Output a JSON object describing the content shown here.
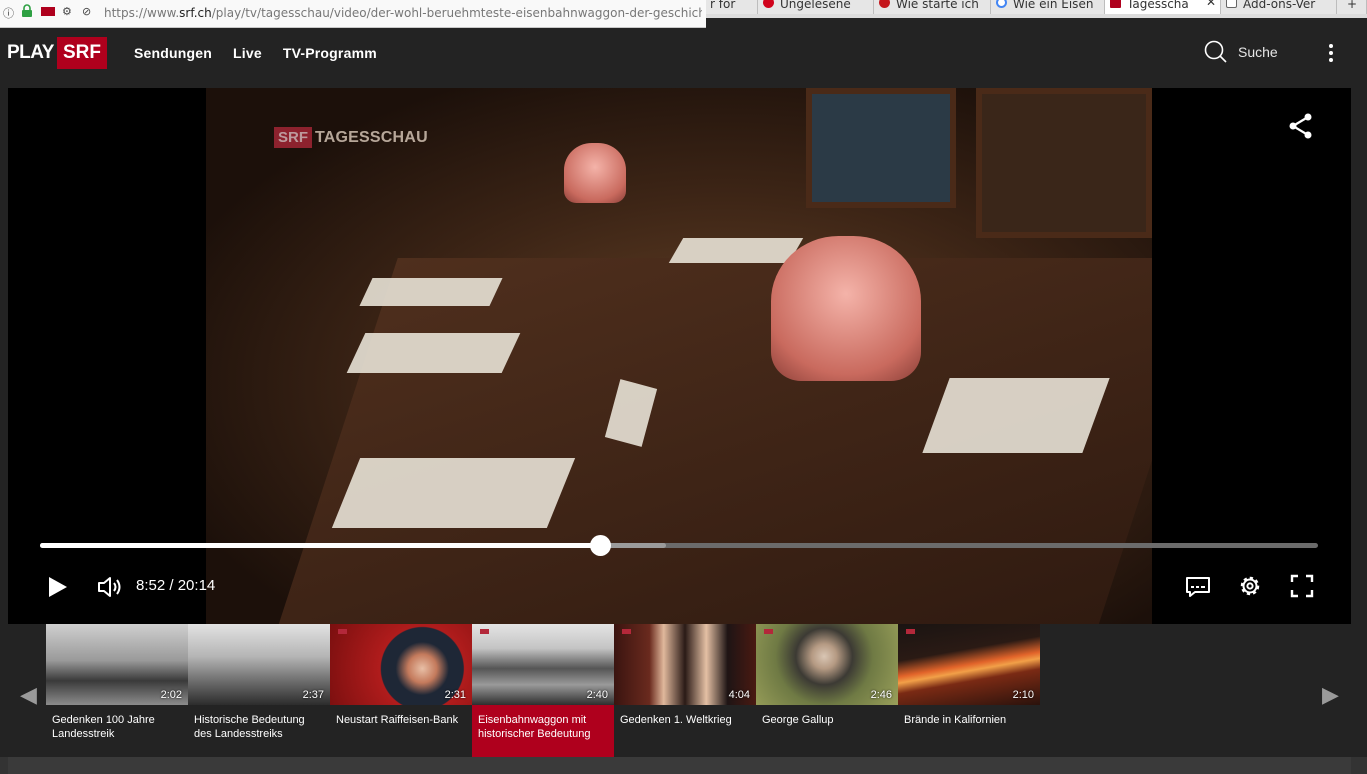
{
  "browser": {
    "url_prefix": "https://www.",
    "url_domain": "srf.ch",
    "url_path": "/play/tv/tagesschau/video/der-wohl-beruehmteste-eisenbahnwaggon-der-geschichte",
    "tabs": [
      {
        "label": "r for",
        "favicon_color": "#e6e6e6"
      },
      {
        "label": "Ungelesene",
        "favicon_color": "#d0021b"
      },
      {
        "label": "Wie starte ich",
        "favicon_color": "#c4161c"
      },
      {
        "label": "Wie ein Eisen",
        "favicon_color": "#4285f4"
      },
      {
        "label": "Tagesscha",
        "favicon_color": "#af001d",
        "active": true
      },
      {
        "label": "Add-ons-Ver",
        "favicon_color": "#666666"
      }
    ]
  },
  "header": {
    "logo_play": "PLAY",
    "logo_srf": "SRF",
    "nav": [
      "Sendungen",
      "Live",
      "TV-Programm"
    ],
    "search_label": "Suche"
  },
  "video": {
    "watermark_srf": "SRF",
    "watermark_show": "TAGESSCHAU"
  },
  "player": {
    "current_time": "8:52",
    "separator": "/",
    "duration": "20:14",
    "progress_fraction": 0.4383,
    "buffer_fraction": 0.49
  },
  "colors": {
    "brand_red": "#af001d",
    "background": "#232323"
  },
  "playlist": [
    {
      "title": "Gedenken 100 Jahre Landesstreik",
      "duration": "2:02",
      "active": false
    },
    {
      "title": "Historische Bedeutung des Landesstreiks",
      "duration": "2:37",
      "active": false
    },
    {
      "title": "Neustart Raiffeisen-Bank",
      "duration": "2:31",
      "active": false
    },
    {
      "title": "Eisenbahnwaggon mit historischer Bedeutung",
      "duration": "2:40",
      "active": true
    },
    {
      "title": "Gedenken 1. Weltkrieg",
      "duration": "4:04",
      "active": false
    },
    {
      "title": "George Gallup",
      "duration": "2:46",
      "active": false
    },
    {
      "title": "Brände in Kalifornien",
      "duration": "2:10",
      "active": false
    }
  ]
}
